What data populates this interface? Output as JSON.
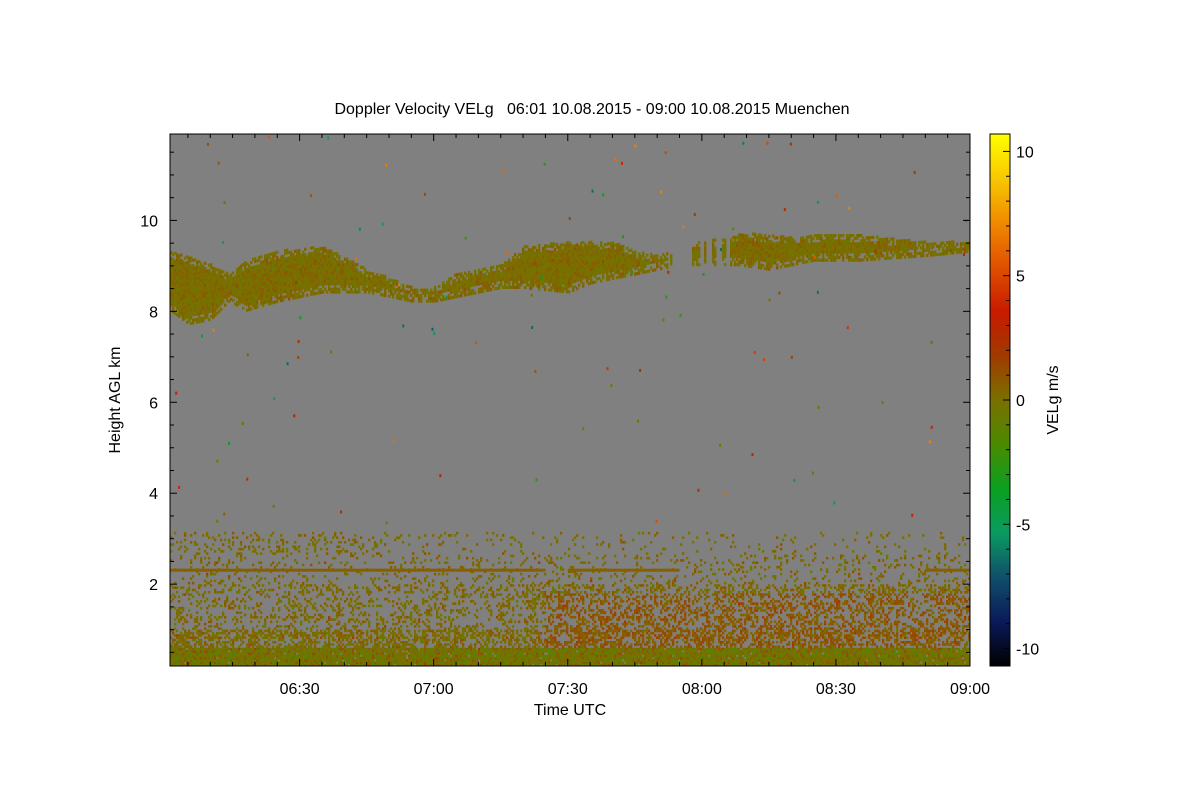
{
  "chart_data": {
    "type": "heatmap",
    "title": "Doppler Velocity VELg   06:01 10.08.2015 - 09:00 10.08.2015 Muenchen",
    "xlabel": "Time UTC",
    "ylabel": "Height AGL km",
    "colorbar_label": "VELg m/s",
    "x_range": [
      "06:01",
      "09:00"
    ],
    "x_ticks": [
      "06:30",
      "07:00",
      "07:30",
      "08:00",
      "08:30",
      "09:00"
    ],
    "ylim": [
      0.2,
      11.9
    ],
    "y_ticks": [
      2,
      4,
      6,
      8,
      10
    ],
    "colorbar_range": [
      -10.7,
      10.7
    ],
    "colorbar_ticks": [
      10,
      5,
      0,
      -5,
      -10
    ],
    "background_color": "#808080",
    "colormap": [
      "#000000",
      "#0a1a5a",
      "#0f4f6a",
      "#0a9a60",
      "#0aa020",
      "#4a8a00",
      "#7a7000",
      "#a03a00",
      "#c81a00",
      "#e05000",
      "#f08a00",
      "#f8c800",
      "#ffff00"
    ],
    "features": [
      {
        "name": "upper cloud layer",
        "height_km": [
          7.6,
          9.7
        ],
        "velocity_ms": [
          -1,
          1
        ]
      },
      {
        "name": "boundary layer returns",
        "height_km": [
          0.2,
          3.1
        ],
        "velocity_ms": [
          -2,
          2
        ]
      },
      {
        "name": "near-surface layer",
        "height_km": [
          0.2,
          0.6
        ],
        "velocity_ms": [
          -2,
          2
        ]
      }
    ],
    "cloud_top_km": [
      [
        "06:01",
        9.3
      ],
      [
        "06:10",
        9.0
      ],
      [
        "06:14",
        8.8
      ],
      [
        "06:18",
        9.1
      ],
      [
        "06:25",
        9.3
      ],
      [
        "06:35",
        9.4
      ],
      [
        "06:45",
        8.9
      ],
      [
        "06:55",
        8.5
      ],
      [
        "07:00",
        8.5
      ],
      [
        "07:05",
        8.8
      ],
      [
        "07:15",
        9.0
      ],
      [
        "07:20",
        9.4
      ],
      [
        "07:30",
        9.5
      ],
      [
        "07:40",
        9.5
      ],
      [
        "07:45",
        9.3
      ],
      [
        "07:50",
        9.2
      ],
      [
        "07:55",
        9.4
      ],
      [
        "08:00",
        9.5
      ],
      [
        "08:10",
        9.7
      ],
      [
        "08:20",
        9.6
      ],
      [
        "08:30",
        9.7
      ],
      [
        "08:40",
        9.6
      ],
      [
        "08:50",
        9.5
      ],
      [
        "09:00",
        9.5
      ]
    ],
    "cloud_base_km": [
      [
        "06:01",
        8.0
      ],
      [
        "06:05",
        7.7
      ],
      [
        "06:10",
        7.8
      ],
      [
        "06:14",
        8.2
      ],
      [
        "06:18",
        8.0
      ],
      [
        "06:25",
        8.2
      ],
      [
        "06:35",
        8.4
      ],
      [
        "06:45",
        8.4
      ],
      [
        "06:55",
        8.2
      ],
      [
        "07:00",
        8.2
      ],
      [
        "07:05",
        8.3
      ],
      [
        "07:15",
        8.5
      ],
      [
        "07:20",
        8.5
      ],
      [
        "07:30",
        8.4
      ],
      [
        "07:35",
        8.6
      ],
      [
        "07:45",
        8.8
      ],
      [
        "07:55",
        9.0
      ],
      [
        "08:00",
        9.0
      ],
      [
        "08:08",
        9.0
      ],
      [
        "08:15",
        8.9
      ],
      [
        "08:25",
        9.1
      ],
      [
        "08:35",
        9.1
      ],
      [
        "08:50",
        9.2
      ],
      [
        "09:00",
        9.3
      ]
    ]
  }
}
